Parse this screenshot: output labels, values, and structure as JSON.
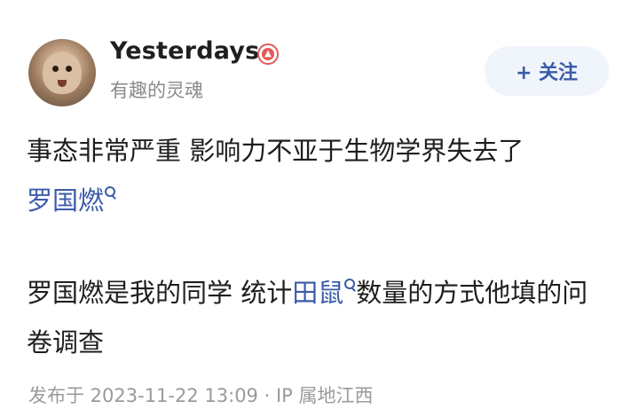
{
  "user": {
    "name": "Yesterdays",
    "signature": "有趣的灵魂"
  },
  "follow": {
    "label": "+ 关注"
  },
  "post": {
    "p1_text": "事态非常严重 影响力不亚于生物学界失去了",
    "p1_topic": "罗国燃",
    "p2_text_a": "罗国燃是我的同学 统计",
    "p2_topic": "田鼠",
    "p2_text_b": "数量的方式他填的问卷调查"
  },
  "meta": {
    "published": "发布于 2023-11-22 13:09",
    "separator": "·",
    "location": "IP 属地江西"
  },
  "colors": {
    "topic": "#3b5ba9",
    "badge": "#e35a5a",
    "follow_bg": "#f0f4fb"
  }
}
